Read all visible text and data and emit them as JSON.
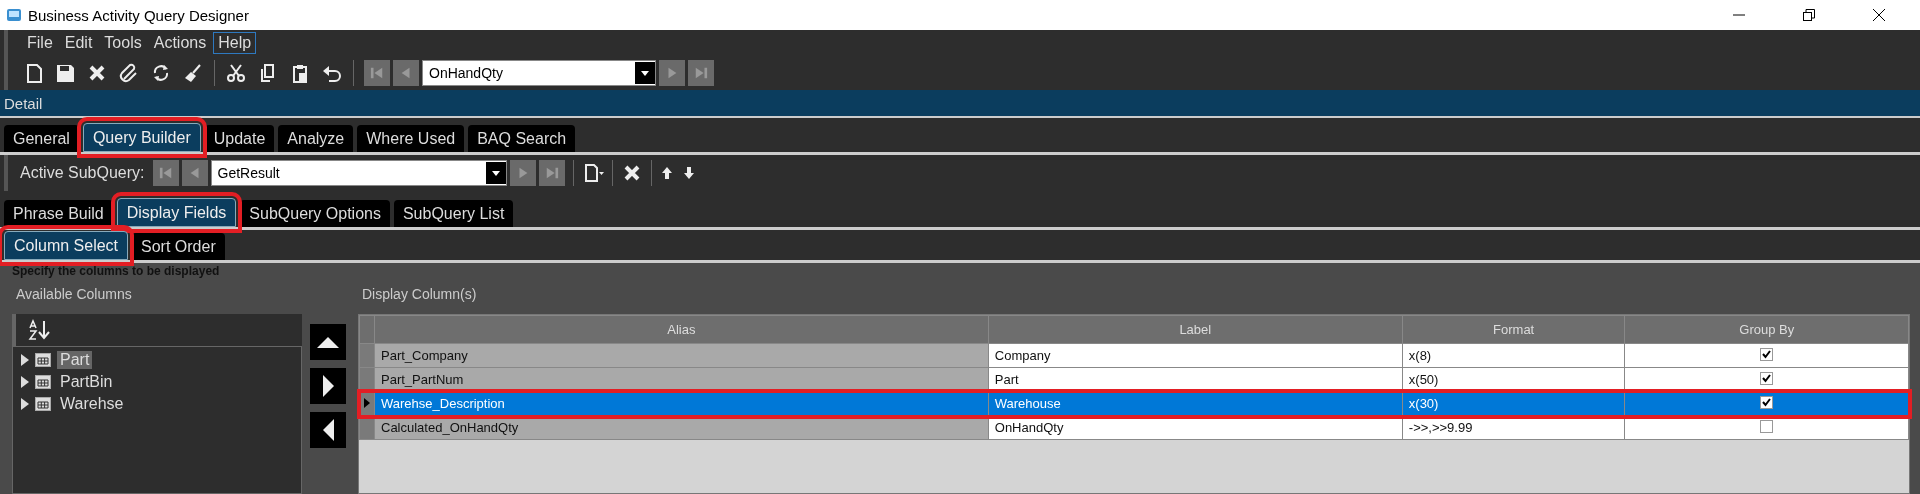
{
  "window": {
    "title": "Business Activity Query Designer"
  },
  "menu": [
    {
      "label": "File",
      "selected": false
    },
    {
      "label": "Edit",
      "selected": false
    },
    {
      "label": "Tools",
      "selected": false
    },
    {
      "label": "Actions",
      "selected": false
    },
    {
      "label": "Help",
      "selected": true
    }
  ],
  "toolbar": {
    "record": "OnHandQty"
  },
  "detail_bar": {
    "title": "Detail"
  },
  "main_tabs": [
    {
      "label": "General",
      "selected": false,
      "callout": false
    },
    {
      "label": "Query Builder",
      "selected": true,
      "callout": true
    },
    {
      "label": "Update",
      "selected": false,
      "callout": false
    },
    {
      "label": "Analyze",
      "selected": false,
      "callout": false
    },
    {
      "label": "Where Used",
      "selected": false,
      "callout": false
    },
    {
      "label": "BAQ Search",
      "selected": false,
      "callout": false
    }
  ],
  "subquery_bar": {
    "label": "Active SubQuery:",
    "value": "GetResult"
  },
  "subquery_tabs": [
    {
      "label": "Phrase Build",
      "selected": false,
      "callout": false
    },
    {
      "label": "Display Fields",
      "selected": true,
      "callout": true
    },
    {
      "label": "SubQuery Options",
      "selected": false,
      "callout": false
    },
    {
      "label": "SubQuery List",
      "selected": false,
      "callout": false
    }
  ],
  "field_tabs": [
    {
      "label": "Column Select",
      "selected": true,
      "callout": true
    },
    {
      "label": "Sort Order",
      "selected": false,
      "callout": false
    }
  ],
  "hint": "Specify the columns to be displayed",
  "available_columns": {
    "title": "Available Columns",
    "items": [
      {
        "label": "Part",
        "selected": true
      },
      {
        "label": "PartBin",
        "selected": false
      },
      {
        "label": "Warehse",
        "selected": false
      }
    ]
  },
  "display_columns": {
    "title": "Display Column(s)",
    "columns": [
      "Alias",
      "Label",
      "Format",
      "Group By"
    ],
    "rows": [
      {
        "alias": "Part_Company",
        "label": "Company",
        "format": "x(8)",
        "group_by": true,
        "selected": false,
        "callout": false
      },
      {
        "alias": "Part_PartNum",
        "label": "Part",
        "format": "x(50)",
        "group_by": true,
        "selected": false,
        "callout": false
      },
      {
        "alias": "Warehse_Description",
        "label": "Warehouse",
        "format": "x(30)",
        "group_by": true,
        "selected": true,
        "callout": true
      },
      {
        "alias": "Calculated_OnHandQty",
        "label": "OnHandQty",
        "format": "->>,>>9.99",
        "group_by": false,
        "selected": false,
        "callout": false
      }
    ]
  }
}
